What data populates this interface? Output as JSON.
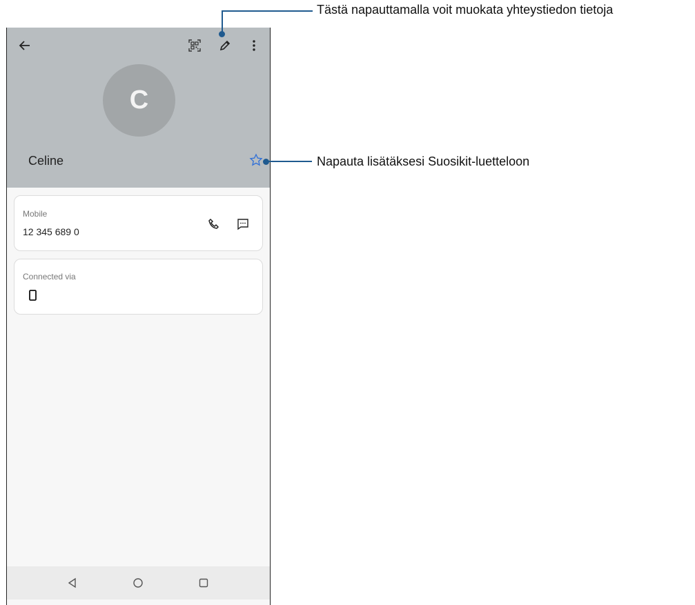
{
  "contact": {
    "initial": "C",
    "name": "Celine"
  },
  "toolbar": {
    "icons": [
      "back-arrow-icon",
      "qr-code-icon",
      "edit-pencil-icon",
      "more-vert-icon"
    ]
  },
  "cards": {
    "mobile": {
      "label": "Mobile",
      "value": "12 345 689 0",
      "actions": [
        "phone-icon",
        "message-icon"
      ]
    },
    "connected": {
      "label": "Connected via",
      "icon": "device-icon"
    }
  },
  "navbar": {
    "icons": [
      "back-triangle-icon",
      "home-circle-icon",
      "recents-square-icon"
    ]
  },
  "callouts": {
    "edit": "Tästä napauttamalla voit muokata yhteystiedon tietoja",
    "favorite": "Napauta lisätäksesi Suosikit-luetteloon"
  },
  "colors": {
    "header": "#b8bdc0",
    "avatar": "#a2a6a8",
    "star_accent": "#2f6fd8",
    "callout_line": "#1f5a8f"
  }
}
